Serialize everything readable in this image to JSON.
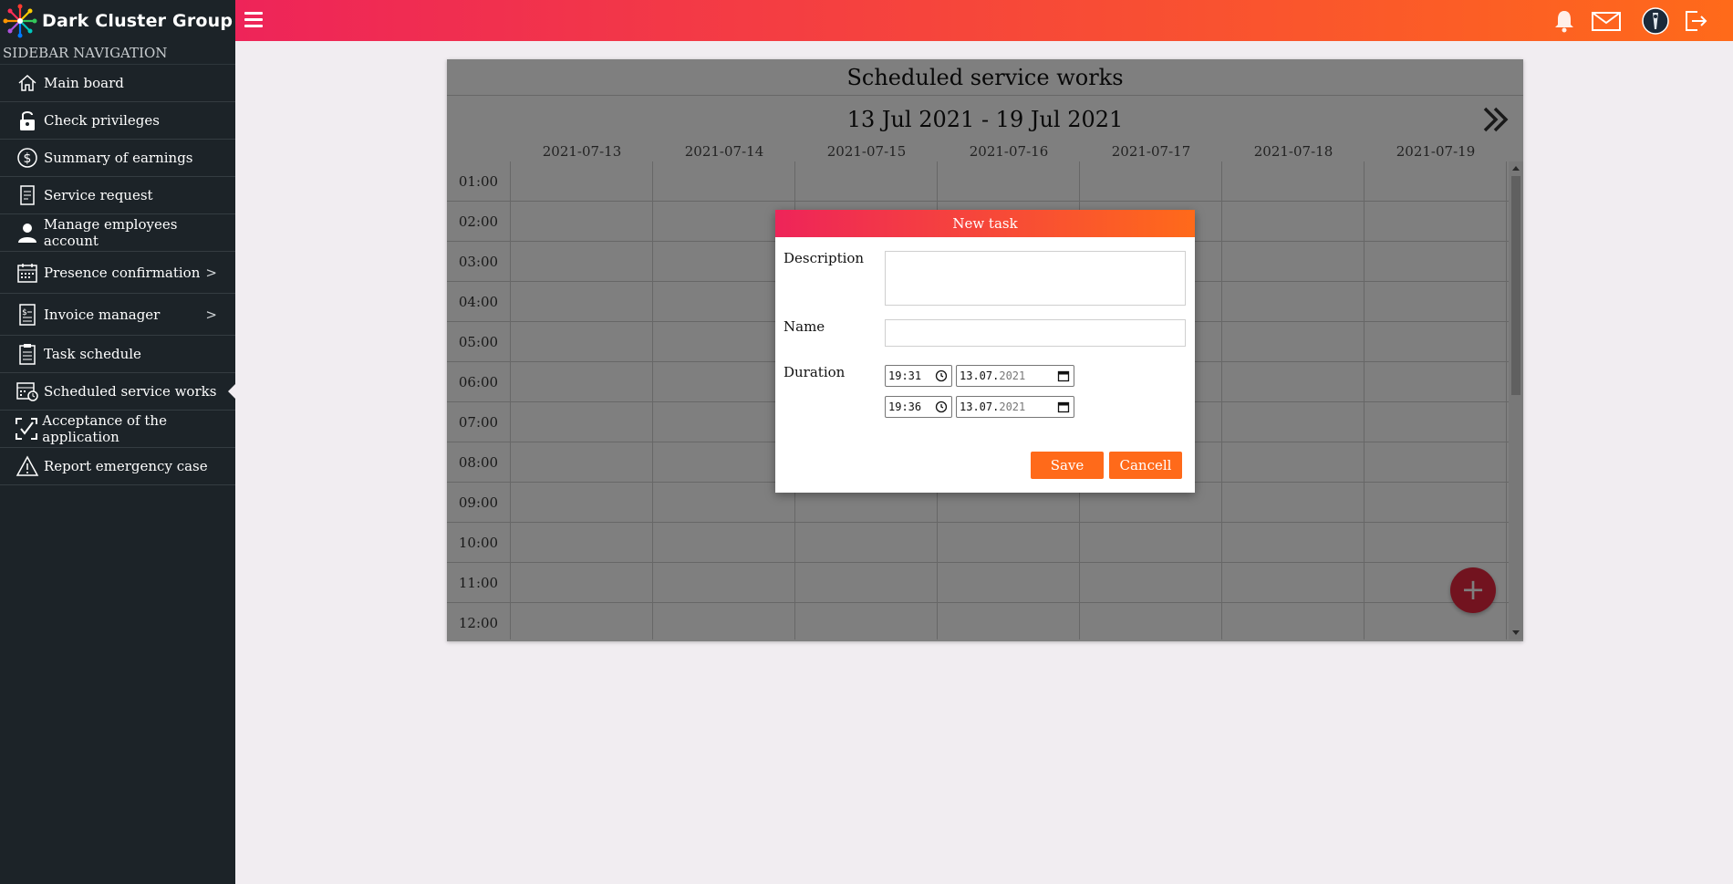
{
  "brand": {
    "name": "Dark Cluster Group"
  },
  "sidebar": {
    "heading": "SIDEBAR NAVIGATION",
    "items": [
      {
        "label": "Main board",
        "icon": "home-icon"
      },
      {
        "label": "Check privileges",
        "icon": "lock-icon"
      },
      {
        "label": "Summary of earnings",
        "icon": "dollar-icon"
      },
      {
        "label": "Service request",
        "icon": "document-icon"
      },
      {
        "label": "Manage employees account",
        "icon": "user-icon"
      },
      {
        "label": "Presence confirmation",
        "icon": "calendar-icon",
        "submenu": true
      },
      {
        "label": "Invoice manager",
        "icon": "invoice-icon",
        "submenu": true
      },
      {
        "label": "Task schedule",
        "icon": "clipboard-icon"
      },
      {
        "label": "Scheduled service works",
        "icon": "calendar-clock-icon",
        "active": true
      },
      {
        "label": "Acceptance of the application",
        "icon": "check-frame-icon"
      },
      {
        "label": "Report emergency case",
        "icon": "warning-icon"
      }
    ],
    "chevron": ">"
  },
  "schedule": {
    "title": "Scheduled service works",
    "week_range": "13 Jul 2021 - 19 Jul 2021",
    "days": [
      "2021-07-13",
      "2021-07-14",
      "2021-07-15",
      "2021-07-16",
      "2021-07-17",
      "2021-07-18",
      "2021-07-19"
    ],
    "hours": [
      "01:00",
      "02:00",
      "03:00",
      "04:00",
      "05:00",
      "06:00",
      "07:00",
      "08:00",
      "09:00",
      "10:00",
      "11:00",
      "12:00"
    ],
    "fab_label": "+"
  },
  "modal": {
    "title": "New task",
    "description_label": "Description",
    "description_value": "",
    "name_label": "Name",
    "name_value": "",
    "duration_label": "Duration",
    "start_time": "19:31",
    "start_date_dm": "13.07.",
    "start_date_year": "2021",
    "end_time": "19:36",
    "end_date_dm": "13.07.",
    "end_date_year": "2021",
    "save_label": "Save",
    "cancel_label": "Cancell"
  },
  "colors": {
    "accent_start": "#ee2459",
    "accent_end": "#ff6a1a",
    "sidebar_bg": "#1c2328",
    "fab": "#e4273e"
  }
}
